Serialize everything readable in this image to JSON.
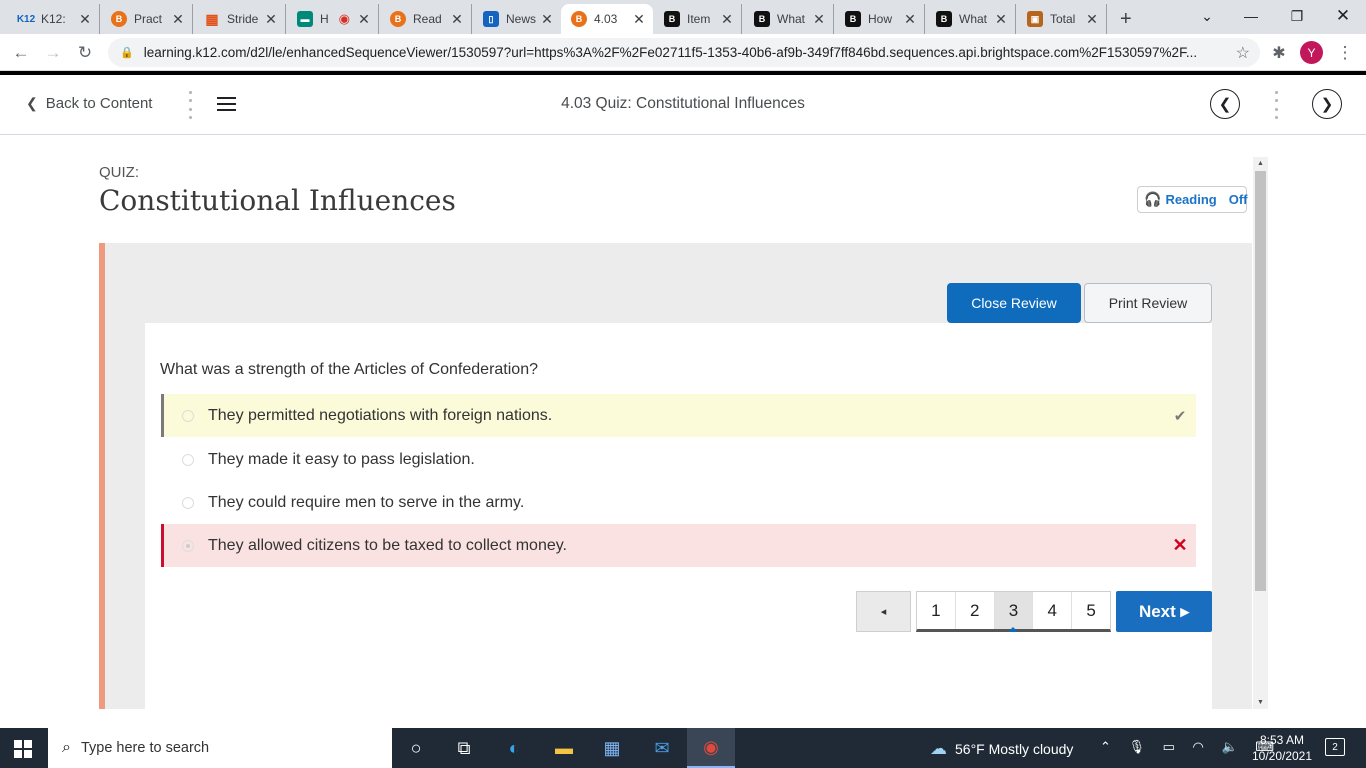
{
  "browser": {
    "tabs": [
      {
        "favicon": "K12",
        "title": "K12: ",
        "color": "#1565c0"
      },
      {
        "favicon": "B",
        "title": "Pract",
        "color": "#e8711a"
      },
      {
        "favicon": "▦",
        "title": "Stride",
        "color": "#e2531c"
      },
      {
        "favicon": "▬",
        "title": "H",
        "color": "#00897b"
      },
      {
        "favicon": "B",
        "title": "Read",
        "color": "#e8711a"
      },
      {
        "favicon": "▯",
        "title": "News",
        "color": "#1565c0"
      },
      {
        "favicon": "B",
        "title": "4.03",
        "color": "#e8711a"
      },
      {
        "favicon": "B",
        "title": "Item",
        "color": "#111111"
      },
      {
        "favicon": "B",
        "title": "What",
        "color": "#111111"
      },
      {
        "favicon": "B",
        "title": "How",
        "color": "#111111"
      },
      {
        "favicon": "B",
        "title": "What",
        "color": "#111111"
      },
      {
        "favicon": "▣",
        "title": "Total",
        "color": "#b5651d"
      }
    ],
    "new_tab": "+",
    "url": "learning.k12.com/d2l/le/enhancedSequenceViewer/1530597?url=https%3A%2F%2Fe02711f5-1353-40b6-af9b-349f7ff846bd.sequences.api.brightspace.com%2F1530597%2F...",
    "avatar_letter": "Y"
  },
  "lms": {
    "back_label": "Back to Content",
    "title": "4.03 Quiz: Constitutional Influences"
  },
  "page": {
    "kicker": "QUIZ:",
    "title": "Constitutional Influences",
    "reading_label": "Reading",
    "reading_state": "Off",
    "close_review": "Close Review",
    "print_review": "Print Review"
  },
  "quiz": {
    "question": "What was a strength of the Articles of Confederation?",
    "answers": [
      {
        "text": "They permitted negotiations with foreign nations.",
        "state": "correct",
        "mark": "✔"
      },
      {
        "text": "They made it easy to pass legislation.",
        "state": "none",
        "mark": ""
      },
      {
        "text": "They could require men to serve in the army.",
        "state": "none",
        "mark": ""
      },
      {
        "text": "They allowed citizens to be taxed to collect money.",
        "state": "wrong",
        "mark": "✕"
      }
    ]
  },
  "pagination": {
    "prev": "◂",
    "pages": [
      "1",
      "2",
      "3",
      "4",
      "5"
    ],
    "current": "3",
    "next": "Next ▸"
  },
  "taskbar": {
    "search_placeholder": "Type here to search",
    "weather": "56°F  Mostly cloudy",
    "time": "8:53 AM",
    "date": "10/20/2021",
    "notifications": "2"
  }
}
